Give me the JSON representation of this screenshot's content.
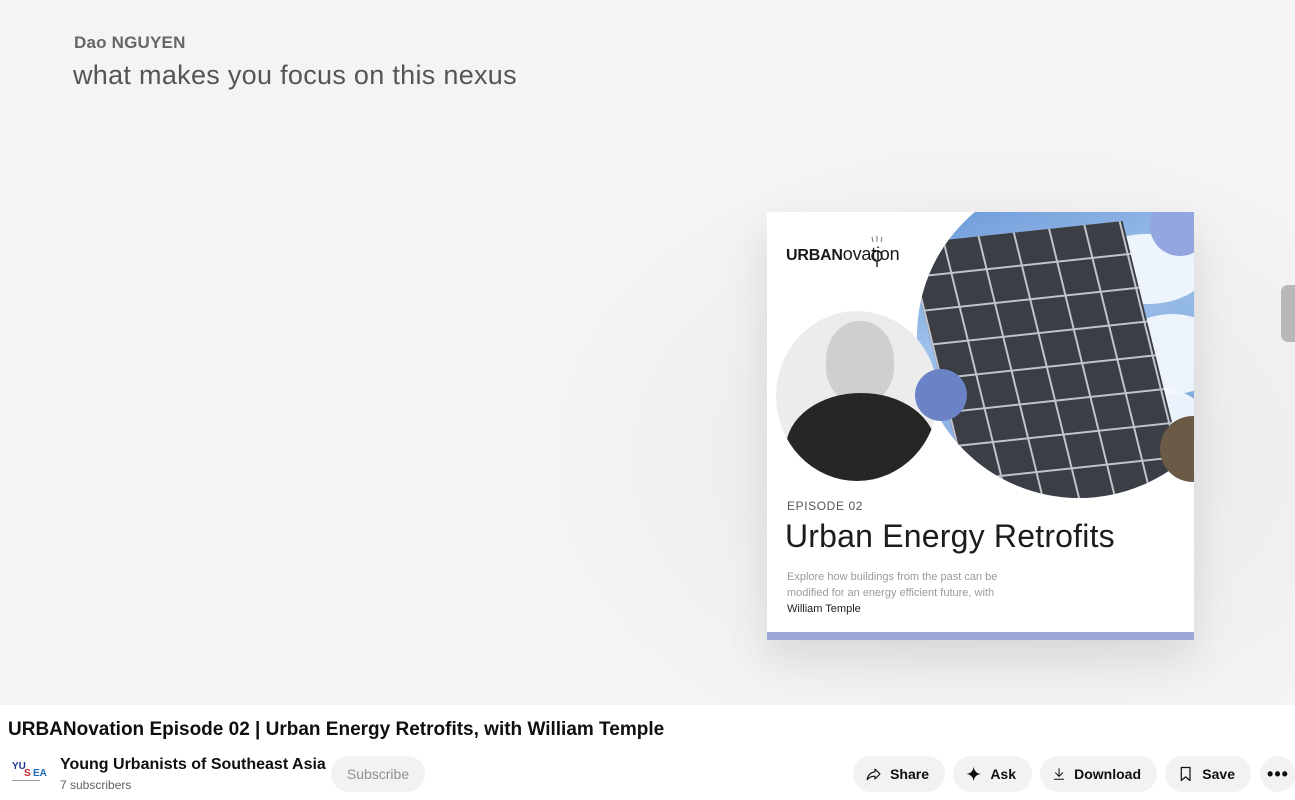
{
  "caption": {
    "speaker": "Dao NGUYEN",
    "text": "what makes you focus on this nexus"
  },
  "cover": {
    "logo_bold": "URBAN",
    "logo_light": "ovation",
    "episode_label": "EPISODE 02",
    "episode_title": "Urban Energy Retrofits",
    "description": "Explore how buildings from the past can be modified for an energy efficient future, with",
    "guest": "William Temple",
    "accent_color": "#9aa7d8"
  },
  "video": {
    "title": "URBANovation Episode 02 | Urban Energy Retrofits, with William Temple"
  },
  "channel": {
    "avatar_text": [
      "YU",
      "S",
      "EA"
    ],
    "name": "Young Urbanists of Southeast Asia",
    "subscribers": "7 subscribers",
    "subscribe_label": "Subscribe"
  },
  "actions": {
    "share": "Share",
    "ask": "Ask",
    "download": "Download",
    "save": "Save",
    "more": "•••"
  }
}
